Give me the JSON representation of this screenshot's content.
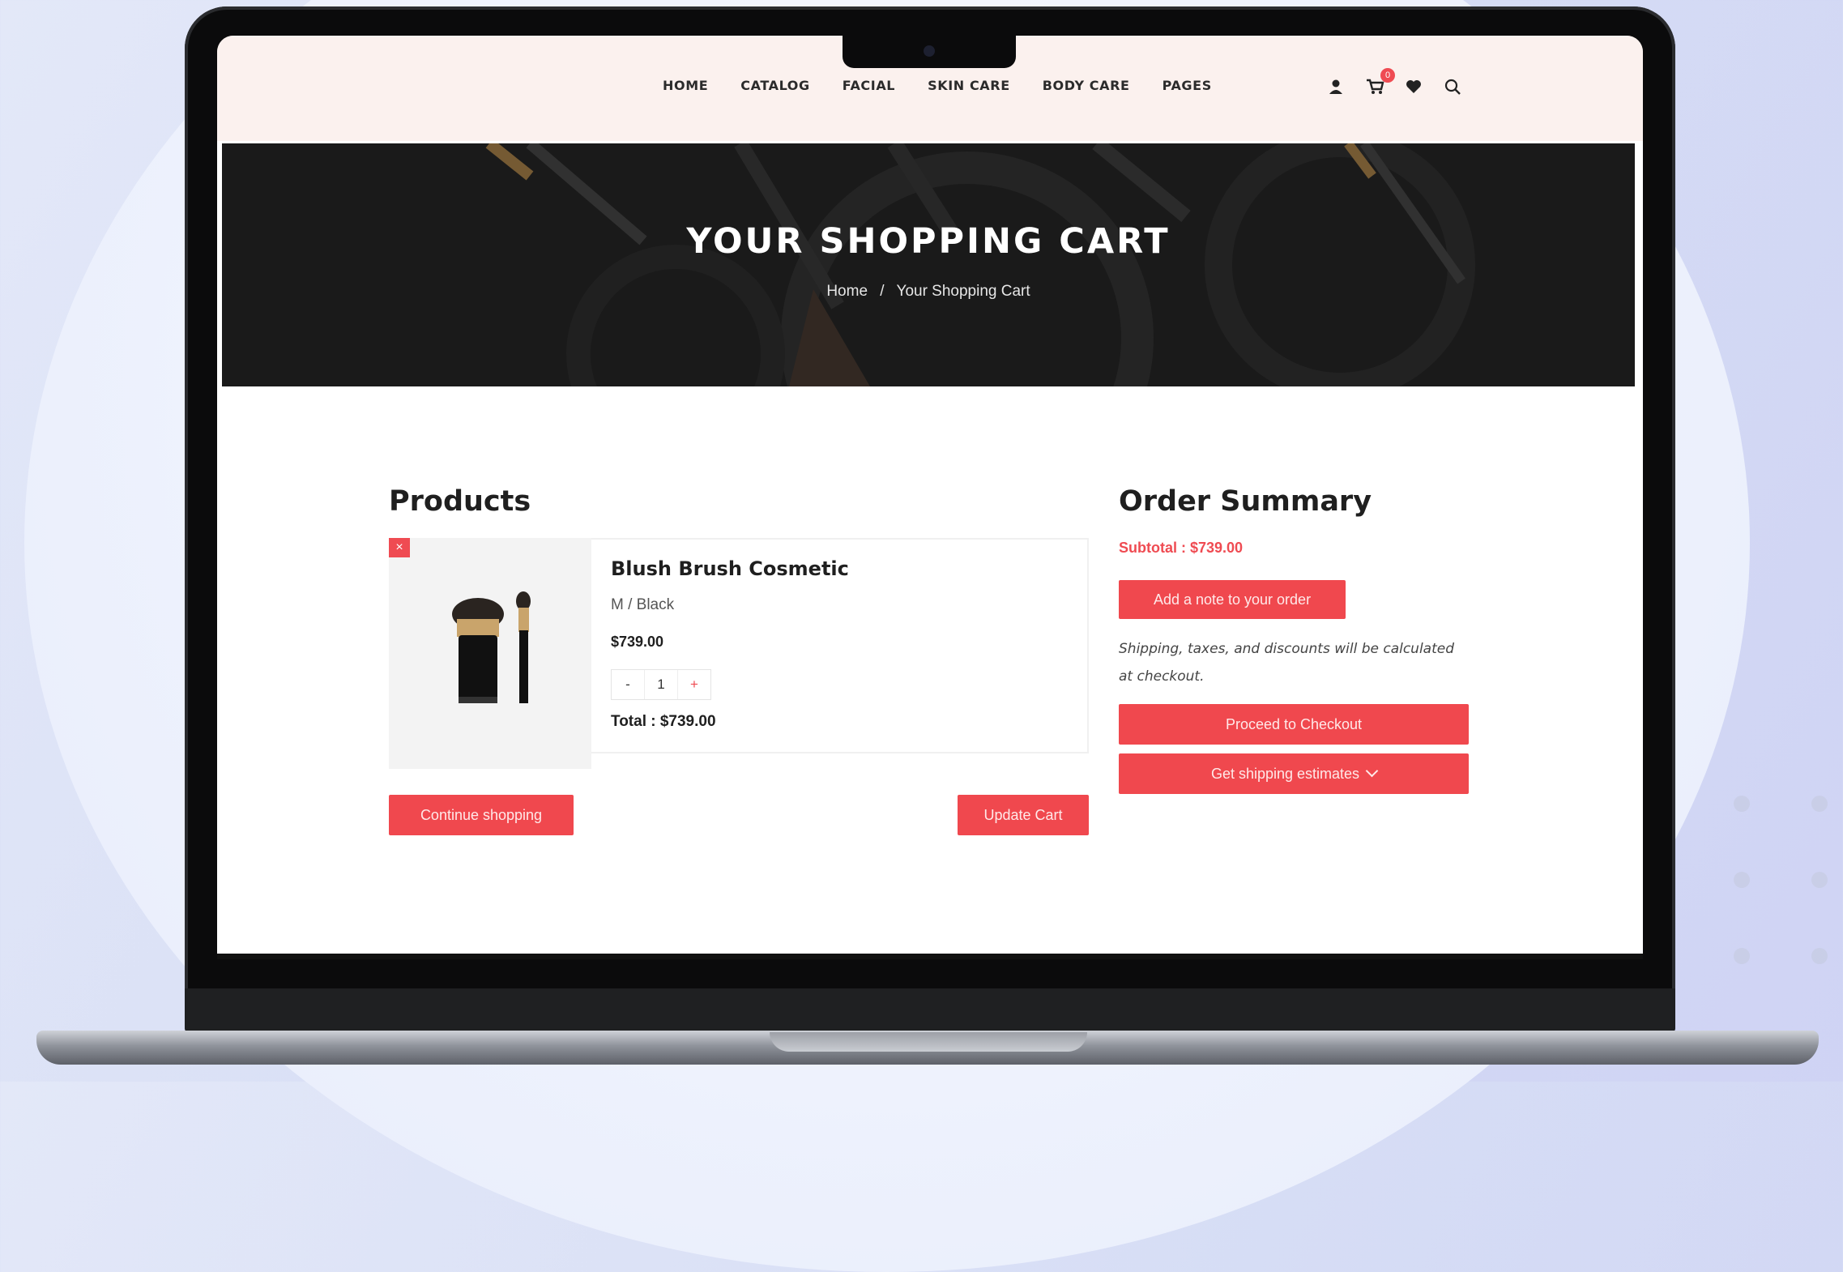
{
  "nav": {
    "items": [
      "HOME",
      "CATALOG",
      "FACIAL",
      "SKIN CARE",
      "BODY CARE",
      "PAGES"
    ],
    "cart_count": "0",
    "icons": [
      "user-icon",
      "cart-icon",
      "heart-icon",
      "search-icon"
    ]
  },
  "hero": {
    "title": "YOUR SHOPPING CART",
    "breadcrumb_home": "Home",
    "breadcrumb_sep": "/",
    "breadcrumb_current": "Your Shopping Cart"
  },
  "products": {
    "heading": "Products",
    "item": {
      "remove": "×",
      "name": "Blush Brush Cosmetic",
      "variant": "M / Black",
      "price": "$739.00",
      "qty_minus": "-",
      "qty": "1",
      "qty_plus": "+",
      "total": "Total : $739.00"
    },
    "continue_label": "Continue shopping",
    "update_label": "Update Cart"
  },
  "summary": {
    "heading": "Order Summary",
    "subtotal": "Subtotal : $739.00",
    "add_note_label": "Add a note to your order",
    "shipping_note": "Shipping, taxes, and discounts will be calculated at checkout.",
    "checkout_label": "Proceed to Checkout",
    "estimates_label": "Get shipping estimates"
  },
  "colors": {
    "accent": "#ef4b52",
    "header_bg": "#fbf1ee",
    "hero_bg": "#1d1d1d"
  }
}
